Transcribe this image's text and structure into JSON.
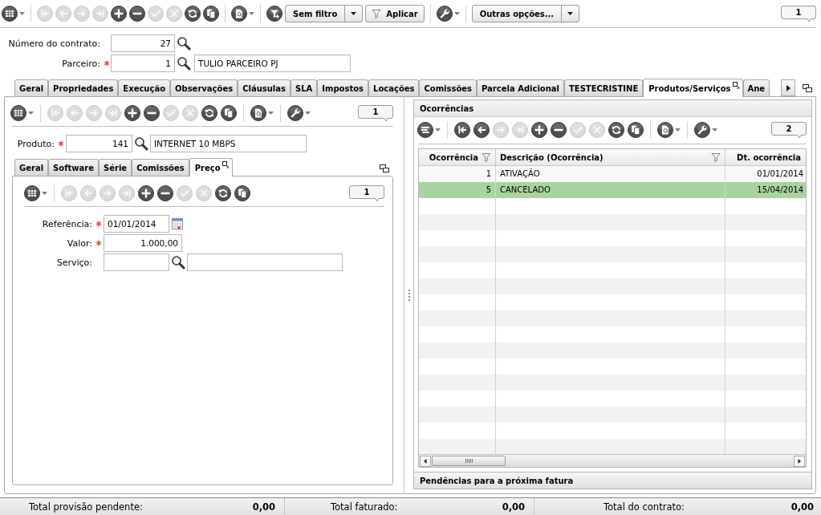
{
  "toolbar": {
    "groups": [
      [
        {
          "kind": "grid",
          "disabled": false
        }
      ],
      [
        {
          "kind": "first",
          "disabled": true
        },
        {
          "kind": "previous",
          "disabled": true
        },
        {
          "kind": "next",
          "disabled": true
        },
        {
          "kind": "last",
          "disabled": true
        },
        {
          "kind": "add",
          "disabled": false
        },
        {
          "kind": "remove",
          "disabled": false
        },
        {
          "kind": "confirm",
          "disabled": true
        },
        {
          "kind": "cancel",
          "disabled": true
        },
        {
          "kind": "refresh",
          "disabled": false
        },
        {
          "kind": "duplicate",
          "disabled": false
        }
      ],
      [
        {
          "kind": "report",
          "disabled": false
        }
      ],
      [
        {
          "kind": "filter",
          "disabled": false
        },
        {
          "kind": "select",
          "label": "Sem filtro",
          "disabled": false
        },
        {
          "kind": "apply",
          "label": "Aplicar",
          "disabled": false
        }
      ],
      [
        {
          "kind": "tools",
          "disabled": false
        }
      ],
      [
        {
          "kind": "select",
          "label": "Outras opções...",
          "disabled": false
        }
      ]
    ],
    "record_count": "1"
  },
  "header_fields": [
    {
      "label": "Número do contrato:",
      "required": false,
      "kind": "lookup",
      "value": "27"
    },
    {
      "label": "Parceiro:",
      "required": true,
      "kind": "lookup_pair",
      "value": "1",
      "description": "TULIO PARCEIRO PJ"
    }
  ],
  "tabs": [
    {
      "label": "Geral",
      "selected": false
    },
    {
      "label": "Propriedades",
      "selected": false
    },
    {
      "label": "Execução",
      "selected": false
    },
    {
      "label": "Observações",
      "selected": false
    },
    {
      "label": "Cláusulas",
      "selected": false
    },
    {
      "label": "SLA",
      "selected": false
    },
    {
      "label": "Impostos",
      "selected": false
    },
    {
      "label": "Locações",
      "selected": false
    },
    {
      "label": "Comissões",
      "selected": false
    },
    {
      "label": "Parcela Adicional",
      "selected": false
    },
    {
      "label": "TESTECRISTINE",
      "selected": false
    },
    {
      "label": "Produtos/Serviços",
      "selected": true
    },
    {
      "label": "Ane",
      "selected": false
    }
  ],
  "products": {
    "toolbar": {
      "groups": [
        [
          {
            "kind": "grid",
            "disabled": false
          }
        ],
        [
          {
            "kind": "first",
            "disabled": true
          },
          {
            "kind": "previous",
            "disabled": true
          },
          {
            "kind": "next",
            "disabled": true
          },
          {
            "kind": "last",
            "disabled": true
          },
          {
            "kind": "add",
            "disabled": false
          },
          {
            "kind": "remove",
            "disabled": false
          },
          {
            "kind": "confirm",
            "disabled": true
          },
          {
            "kind": "cancel",
            "disabled": true
          },
          {
            "kind": "refresh",
            "disabled": false
          },
          {
            "kind": "duplicate",
            "disabled": false
          }
        ],
        [
          {
            "kind": "report",
            "disabled": false
          }
        ],
        [
          {
            "kind": "tools",
            "disabled": false
          }
        ]
      ],
      "record_count": "1"
    },
    "fields": [
      {
        "label": "Produto:",
        "required": true,
        "kind": "lookup_pair",
        "value": "141",
        "description": "INTERNET 10 MBPS"
      }
    ],
    "tabs": [
      {
        "label": "Geral",
        "selected": false
      },
      {
        "label": "Software",
        "selected": false
      },
      {
        "label": "Série",
        "selected": false
      },
      {
        "label": "Comissões",
        "selected": false
      },
      {
        "label": "Preço",
        "selected": true
      }
    ],
    "price": {
      "toolbar": {
        "groups": [
          [
            {
              "kind": "grid",
              "disabled": false
            }
          ],
          [
            {
              "kind": "first",
              "disabled": true
            },
            {
              "kind": "previous",
              "disabled": true
            },
            {
              "kind": "next",
              "disabled": true
            },
            {
              "kind": "last",
              "disabled": true
            },
            {
              "kind": "add",
              "disabled": false
            },
            {
              "kind": "remove",
              "disabled": false
            },
            {
              "kind": "confirm",
              "disabled": true
            },
            {
              "kind": "cancel",
              "disabled": true
            },
            {
              "kind": "refresh",
              "disabled": false
            },
            {
              "kind": "duplicate",
              "disabled": false
            }
          ]
        ],
        "record_count": "1"
      },
      "fields": [
        {
          "label": "Referência:",
          "required": true,
          "kind": "date",
          "value": "01/01/2014"
        },
        {
          "label": "Valor:",
          "required": true,
          "kind": "amount",
          "value": "1.000,00"
        },
        {
          "label": "Serviço:",
          "required": false,
          "kind": "lookup_pair"
        }
      ]
    }
  },
  "occurrences": {
    "title": "Ocorrências",
    "toolbar": {
      "groups": [
        [
          {
            "kind": "list",
            "disabled": false
          }
        ],
        [
          {
            "kind": "first",
            "disabled": false
          },
          {
            "kind": "previous",
            "disabled": false
          },
          {
            "kind": "next",
            "disabled": true
          },
          {
            "kind": "last",
            "disabled": true
          },
          {
            "kind": "add",
            "disabled": false
          },
          {
            "kind": "remove",
            "disabled": false
          },
          {
            "kind": "confirm",
            "disabled": true
          },
          {
            "kind": "cancel",
            "disabled": true
          },
          {
            "kind": "refresh",
            "disabled": false
          },
          {
            "kind": "duplicate",
            "disabled": false
          }
        ],
        [
          {
            "kind": "report",
            "disabled": false
          }
        ],
        [
          {
            "kind": "tools",
            "disabled": false
          }
        ]
      ],
      "record_count": "2"
    },
    "table": {
      "columns": [
        {
          "label": "Ocorrência",
          "filter": true
        },
        {
          "label": "Descrição (Ocorrência)",
          "filter": true
        },
        {
          "label": "Dt. ocorrência",
          "filter": false
        }
      ],
      "rows": [
        {
          "cells": [
            "1",
            "ATIVAÇÃO",
            "01/01/2014"
          ],
          "selected": false
        },
        {
          "cells": [
            "5",
            "CANCELADO",
            "15/04/2014"
          ],
          "selected": true
        }
      ]
    },
    "footer": "Pendências para a próxima fatura"
  },
  "status_bar": {
    "totals": [
      {
        "label": "Total provisão pendente:",
        "value": "0,00"
      },
      {
        "label": "Total faturado:",
        "value": "0,00"
      },
      {
        "label": "Total do contrato:",
        "value": "0,00"
      }
    ]
  }
}
